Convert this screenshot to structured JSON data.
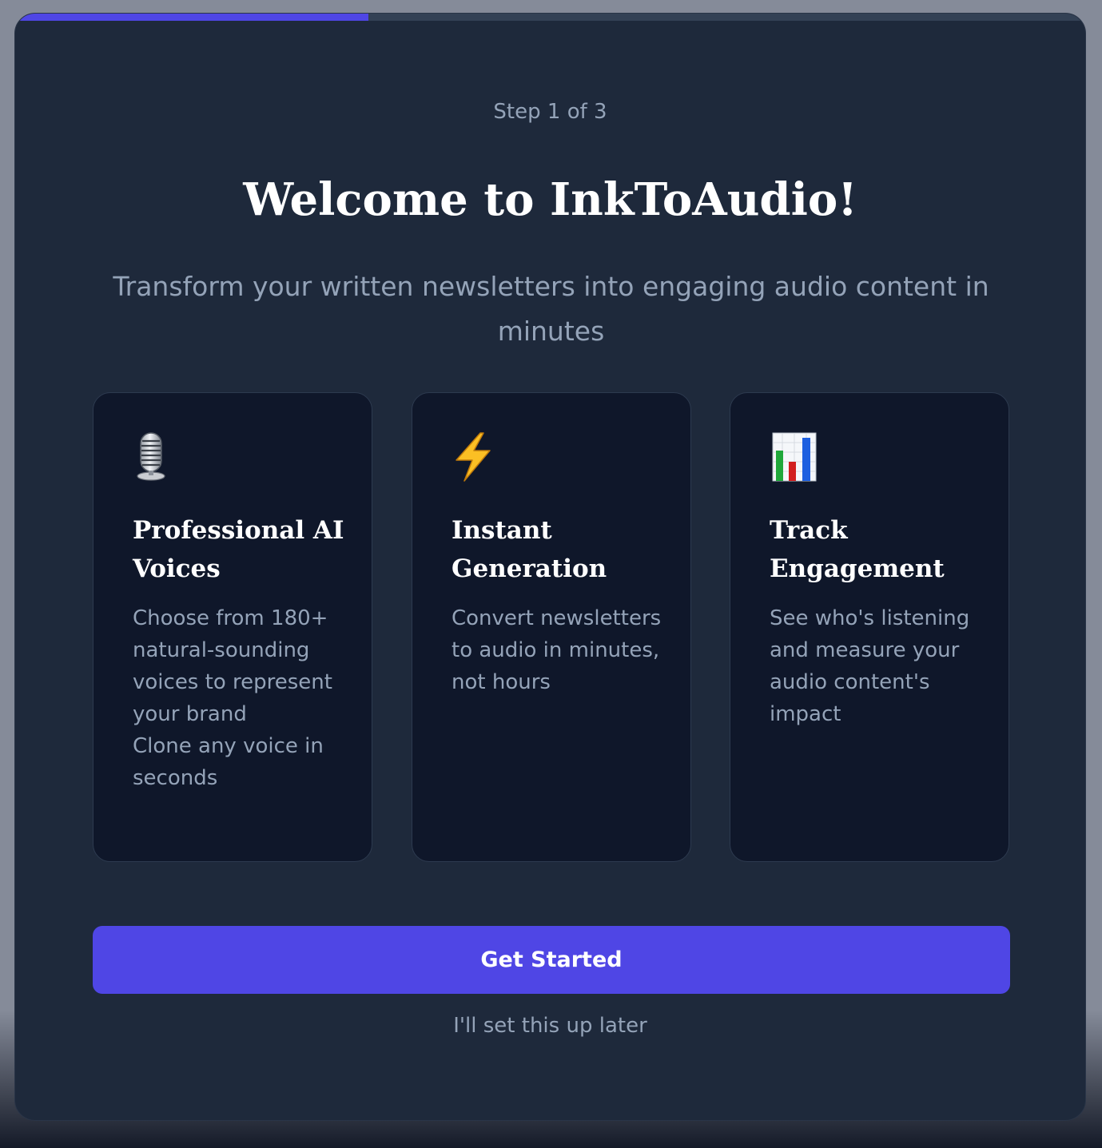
{
  "progress": {
    "fraction": 0.33,
    "color": "#4f46e5"
  },
  "header": {
    "step": "Step 1 of 3",
    "title": "Welcome to InkToAudio!",
    "subtitle": "Transform your written newsletters into engaging audio content in minutes"
  },
  "features": [
    {
      "icon": "microphone-icon",
      "title": "Professional AI Voices",
      "desc1": "Choose from 180+ natural-sounding voices to represent your brand",
      "desc2": "Clone any voice in seconds"
    },
    {
      "icon": "lightning-icon",
      "title": "Instant Generation",
      "desc1": "Convert newsletters to audio in minutes, not hours"
    },
    {
      "icon": "bar-chart-icon",
      "title": "Track Engagement",
      "desc1": "See who's listening and measure your audio content's impact"
    }
  ],
  "actions": {
    "primary_label": "Get Started",
    "secondary_label": "I'll set this up later"
  },
  "colors": {
    "accent": "#4f46e5",
    "modal_bg": "#1e293b",
    "card_bg": "#0f172a",
    "muted_text": "#94a3b8"
  }
}
